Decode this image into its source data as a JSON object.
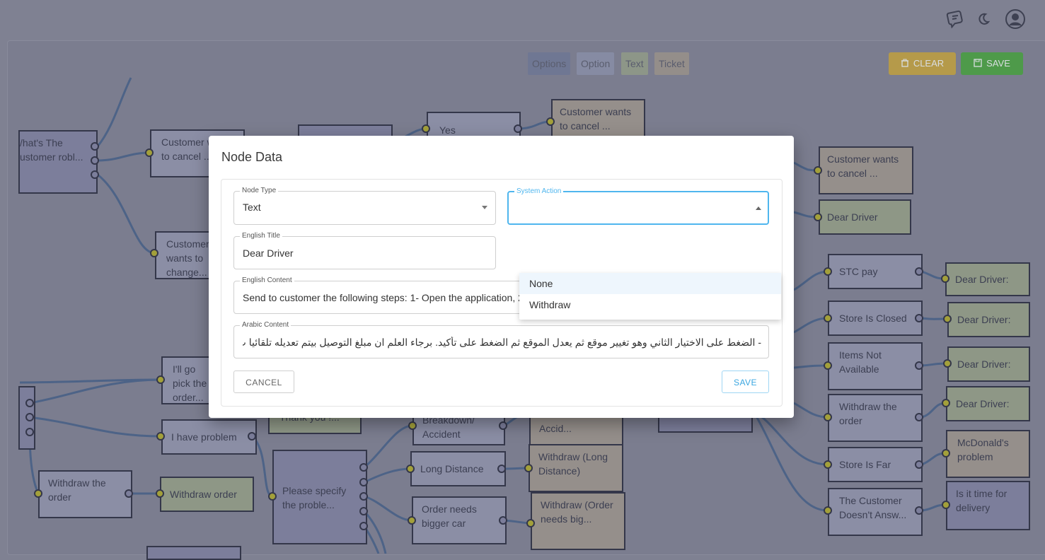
{
  "toolbar": {
    "legend": [
      "Options",
      "Option",
      "Text",
      "Ticket"
    ],
    "clear_label": "CLEAR",
    "save_label": "SAVE"
  },
  "flow_nodes": {
    "n1": "/hat's The ustomer robl...",
    "n2": "Customer wants to cancel ...",
    "n3": "Customer wants to change...",
    "n4": "Yes",
    "n5": "Customer wants to cancel ...",
    "n6": "Customer wants to cancel ...",
    "n7": "Dear Driver",
    "n8": "STC pay",
    "n9": "Dear Driver:",
    "n10": "Store Is Closed",
    "n11": "Dear Driver:",
    "n12": "Items Not Available",
    "n13": "Dear Driver:",
    "n14": "Withdraw the order",
    "n15": "Dear Driver:",
    "n16": "Store Is Far",
    "n17": "McDonald's problem",
    "n18": "The Customer Doesn't Answ...",
    "n19": "Is it time for delivery",
    "n20": "I'll go pick the order...",
    "n21": "Thank you !...",
    "n22": "I have problem",
    "n23": "Withdraw the order",
    "n24": "Withdraw order",
    "n25": "Please specify the proble...",
    "n26": "Breakdown/ Accident",
    "n27": "Accid...",
    "n28": "Long Distance",
    "n29": "Withdraw (Long Distance)",
    "n30": "Order needs bigger car",
    "n31": "Withdraw (Order needs big..."
  },
  "modal": {
    "title": "Node Data",
    "node_type": {
      "label": "Node Type",
      "value": "Text"
    },
    "system_action": {
      "label": "System Action",
      "value": "",
      "options": [
        "None",
        "Withdraw"
      ]
    },
    "english_title": {
      "label": "English Title",
      "value": "Dear Driver"
    },
    "english_content": {
      "label": "English Content",
      "value": "Send to customer the following steps:  1- Open the application, 2- Click on 'My Orders' and select current order, 3-"
    },
    "arabic_content": {
      "label": "Arabic Content",
      "value": "- الضغط على الاختيار الثاني وهو تغيير موقع ثم يعدل الموقع ثم الضغط على تأكيد.   برجاء العلم ان مبلغ التوصيل بيتم تعديله تلقائيا ب"
    },
    "cancel_label": "CANCEL",
    "save_label": "SAVE"
  },
  "colors": {
    "overlay_bg": "#7f8192",
    "accent": "#4fb6ee",
    "clear_btn": "#b59a4a",
    "save_btn": "#4e9a4a"
  },
  "icons": [
    "chat-icon",
    "moon-icon",
    "account-icon",
    "trash-icon",
    "floppy-icon"
  ]
}
